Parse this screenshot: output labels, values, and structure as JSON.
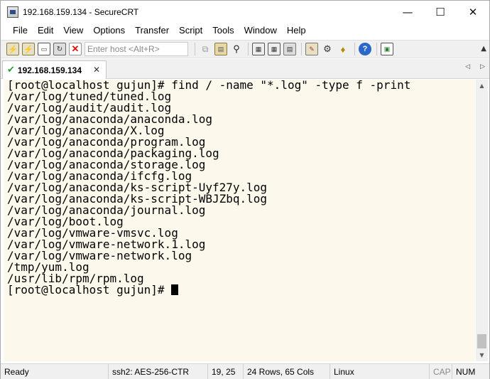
{
  "window": {
    "title": "192.168.159.134 - SecureCRT",
    "controls": {
      "minimize": "—",
      "maximize": "☐",
      "close": "✕"
    }
  },
  "menu": [
    "File",
    "Edit",
    "View",
    "Options",
    "Transfer",
    "Script",
    "Tools",
    "Window",
    "Help"
  ],
  "toolbar": {
    "host_placeholder": "Enter host <Alt+R>",
    "icons": [
      "connect-icon",
      "quick-connect-icon",
      "connect-tab-icon",
      "reconnect-icon",
      "disconnect-icon",
      "copy-icon",
      "paste-icon",
      "find-icon",
      "print-icon",
      "print-setup-icon",
      "print-screen-icon",
      "session-options-icon",
      "global-options-icon",
      "keymap-icon",
      "help-icon",
      "sftp-icon"
    ]
  },
  "tabs": [
    {
      "label": "192.168.159.134",
      "active": true
    }
  ],
  "terminal": {
    "background": "#fcf8ec",
    "lines": [
      "[root@localhost gujun]# find / -name \"*.log\" -type f -print",
      "/var/log/tuned/tuned.log",
      "/var/log/audit/audit.log",
      "/var/log/anaconda/anaconda.log",
      "/var/log/anaconda/X.log",
      "/var/log/anaconda/program.log",
      "/var/log/anaconda/packaging.log",
      "/var/log/anaconda/storage.log",
      "/var/log/anaconda/ifcfg.log",
      "/var/log/anaconda/ks-script-Uyf27y.log",
      "/var/log/anaconda/ks-script-WBJZbq.log",
      "/var/log/anaconda/journal.log",
      "/var/log/boot.log",
      "/var/log/vmware-vmsvc.log",
      "/var/log/vmware-network.1.log",
      "/var/log/vmware-network.log",
      "/tmp/yum.log",
      "/usr/lib/rpm/rpm.log"
    ],
    "prompt": "[root@localhost gujun]# "
  },
  "status": {
    "state": "Ready",
    "encryption": "ssh2: AES-256-CTR",
    "position": "19,  25",
    "size": "24 Rows, 65 Cols",
    "terminal_type": "Linux",
    "cap": "CAP",
    "num": "NUM"
  }
}
